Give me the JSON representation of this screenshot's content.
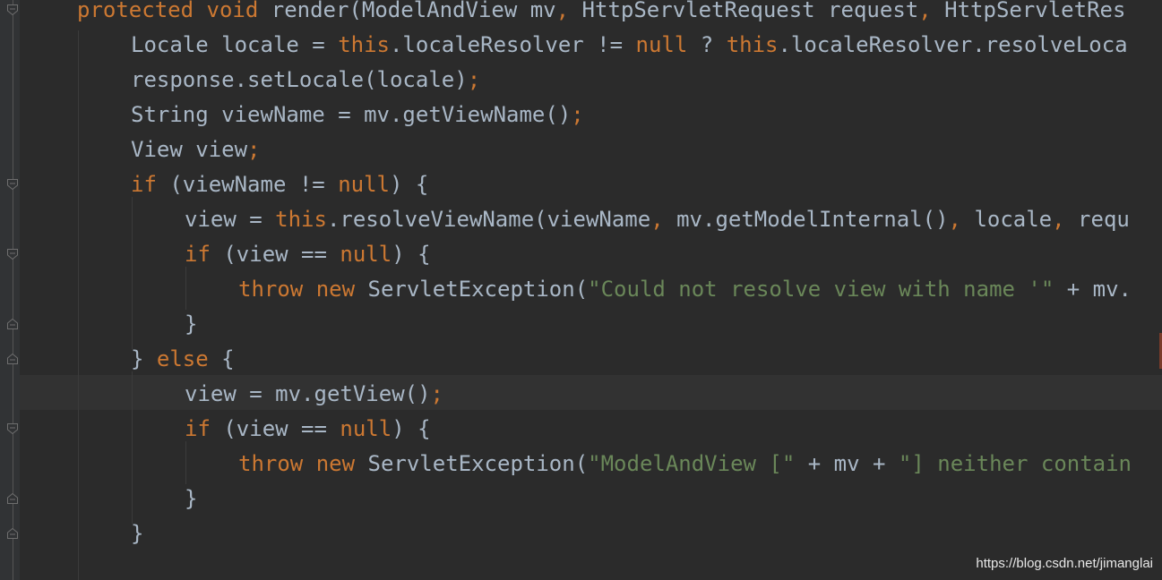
{
  "editor": {
    "lines": [
      {
        "indent": 1,
        "tokens": [
          {
            "t": "protected void ",
            "c": "kw"
          },
          {
            "t": "render(ModelAndView mv",
            "c": "plain"
          },
          {
            "t": ", ",
            "c": "kw"
          },
          {
            "t": "HttpServletRequest request",
            "c": "plain"
          },
          {
            "t": ", ",
            "c": "kw"
          },
          {
            "t": "HttpServletRes",
            "c": "plain"
          }
        ]
      },
      {
        "indent": 2,
        "tokens": [
          {
            "t": "Locale locale = ",
            "c": "plain"
          },
          {
            "t": "this",
            "c": "kw"
          },
          {
            "t": ".localeResolver != ",
            "c": "plain"
          },
          {
            "t": "null",
            "c": "kw"
          },
          {
            "t": " ? ",
            "c": "plain"
          },
          {
            "t": "this",
            "c": "kw"
          },
          {
            "t": ".localeResolver.resolveLoca",
            "c": "plain"
          }
        ]
      },
      {
        "indent": 2,
        "tokens": [
          {
            "t": "response.setLocale(locale)",
            "c": "plain"
          },
          {
            "t": ";",
            "c": "kw"
          }
        ]
      },
      {
        "indent": 2,
        "tokens": [
          {
            "t": "String viewName = mv.getViewName()",
            "c": "plain"
          },
          {
            "t": ";",
            "c": "kw"
          }
        ]
      },
      {
        "indent": 2,
        "tokens": [
          {
            "t": "View view",
            "c": "plain"
          },
          {
            "t": ";",
            "c": "kw"
          }
        ]
      },
      {
        "indent": 2,
        "tokens": [
          {
            "t": "if ",
            "c": "kw"
          },
          {
            "t": "(viewName != ",
            "c": "plain"
          },
          {
            "t": "null",
            "c": "kw"
          },
          {
            "t": ") {",
            "c": "plain"
          }
        ]
      },
      {
        "indent": 3,
        "tokens": [
          {
            "t": "view = ",
            "c": "plain"
          },
          {
            "t": "this",
            "c": "kw"
          },
          {
            "t": ".resolveViewName(viewName",
            "c": "plain"
          },
          {
            "t": ", ",
            "c": "kw"
          },
          {
            "t": "mv.getModelInternal()",
            "c": "plain"
          },
          {
            "t": ", ",
            "c": "kw"
          },
          {
            "t": "locale",
            "c": "plain"
          },
          {
            "t": ", ",
            "c": "kw"
          },
          {
            "t": "requ",
            "c": "plain"
          }
        ]
      },
      {
        "indent": 3,
        "tokens": [
          {
            "t": "if ",
            "c": "kw"
          },
          {
            "t": "(view == ",
            "c": "plain"
          },
          {
            "t": "null",
            "c": "kw"
          },
          {
            "t": ") {",
            "c": "plain"
          }
        ]
      },
      {
        "indent": 4,
        "tokens": [
          {
            "t": "throw new ",
            "c": "kw"
          },
          {
            "t": "ServletException(",
            "c": "plain"
          },
          {
            "t": "\"Could not resolve view with name '\"",
            "c": "str"
          },
          {
            "t": " + mv.",
            "c": "plain"
          }
        ]
      },
      {
        "indent": 3,
        "tokens": [
          {
            "t": "}",
            "c": "plain"
          }
        ]
      },
      {
        "indent": 2,
        "tokens": [
          {
            "t": "} ",
            "c": "plain"
          },
          {
            "t": "else ",
            "c": "kw"
          },
          {
            "t": "{",
            "c": "plain"
          }
        ]
      },
      {
        "indent": 3,
        "tokens": [
          {
            "t": "view = mv.getView()",
            "c": "plain"
          },
          {
            "t": ";",
            "c": "kw"
          }
        ]
      },
      {
        "indent": 3,
        "tokens": [
          {
            "t": "if ",
            "c": "kw"
          },
          {
            "t": "(view == ",
            "c": "plain"
          },
          {
            "t": "null",
            "c": "kw"
          },
          {
            "t": ") {",
            "c": "plain"
          }
        ]
      },
      {
        "indent": 4,
        "tokens": [
          {
            "t": "throw new ",
            "c": "kw"
          },
          {
            "t": "ServletException(",
            "c": "plain"
          },
          {
            "t": "\"ModelAndView [\"",
            "c": "str"
          },
          {
            "t": " + mv + ",
            "c": "plain"
          },
          {
            "t": "\"] neither contain",
            "c": "str"
          }
        ]
      },
      {
        "indent": 3,
        "tokens": [
          {
            "t": "}",
            "c": "plain"
          }
        ]
      },
      {
        "indent": 2,
        "tokens": [
          {
            "t": "}",
            "c": "plain"
          }
        ]
      }
    ],
    "current_line": 11
  },
  "colors": {
    "background": "#2b2b2b",
    "keyword": "#cc7832",
    "string": "#6a8759",
    "identifier": "#a9b7c6",
    "current_line": "#323232"
  },
  "watermark": "https://blog.csdn.net/jimanglai"
}
